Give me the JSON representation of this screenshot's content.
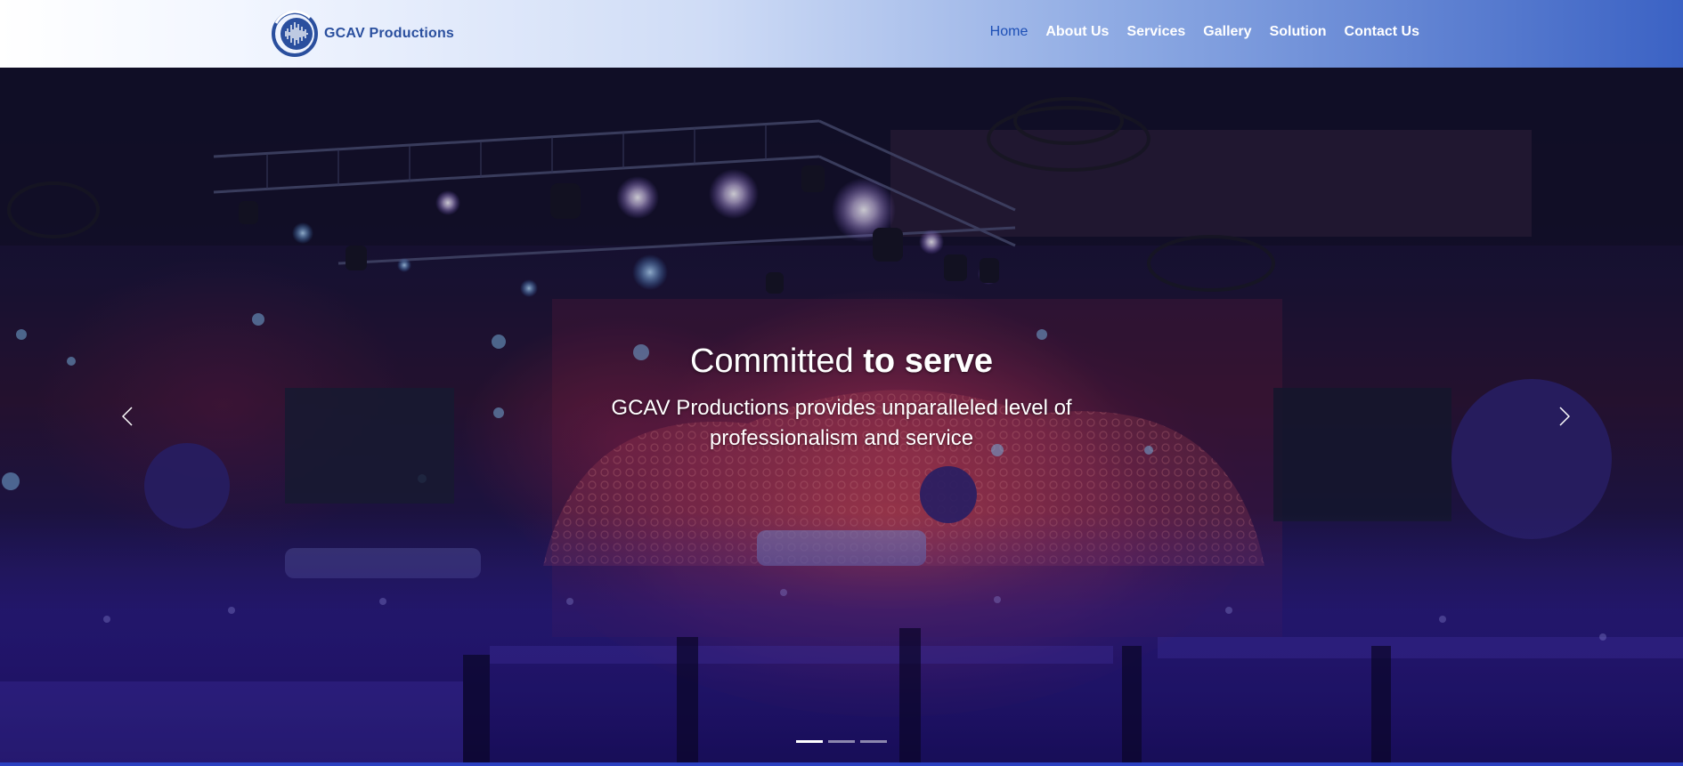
{
  "brand": {
    "name": "GCAV Productions",
    "logo_icon": "equalizer-circle-logo",
    "logo_color": "#2a4f9e"
  },
  "nav": {
    "items": [
      {
        "label": "Home",
        "active": true
      },
      {
        "label": "About Us",
        "active": false
      },
      {
        "label": "Services",
        "active": false
      },
      {
        "label": "Gallery",
        "active": false
      },
      {
        "label": "Solution",
        "active": false
      },
      {
        "label": "Contact Us",
        "active": false
      }
    ],
    "active_color": "#1d4fb6"
  },
  "hero": {
    "title_part1": "Committed ",
    "title_part2": "to serve",
    "subtitle": "GCAV Productions provides unparalleled level of professionalism and service",
    "prev_icon": "chevron-left-icon",
    "next_icon": "chevron-right-icon",
    "slides_count": 3,
    "active_slide": 1
  },
  "colors": {
    "header_gradient_start": "#ffffff",
    "header_gradient_end": "#3b62c4",
    "footer_bar": "#2b40c0"
  }
}
